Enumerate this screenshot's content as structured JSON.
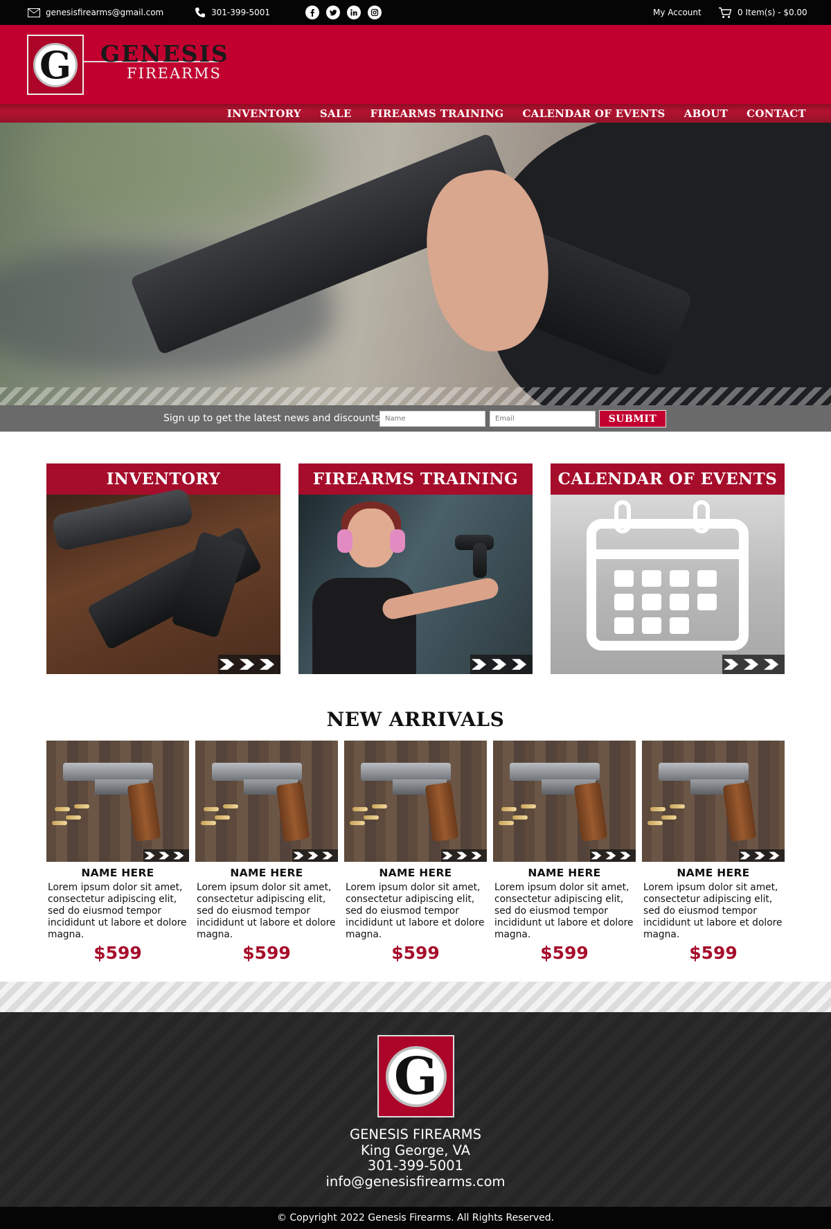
{
  "topbar": {
    "email": "genesisfirearms@gmail.com",
    "phone": "301-399-5001",
    "social": [
      "facebook-icon",
      "twitter-icon",
      "linkedin-icon",
      "instagram-icon"
    ],
    "account": "My Account",
    "cart": "0 Item(s) - $0.00"
  },
  "brand": {
    "logo_letter": "G",
    "name_line1": "GENESIS",
    "name_line2": "FIREARMS"
  },
  "nav": {
    "items": [
      "INVENTORY",
      "SALE",
      "FIREARMS TRAINING",
      "CALENDAR OF EVENTS",
      "ABOUT",
      "CONTACT"
    ]
  },
  "signup": {
    "label": "Sign up to get the latest news and discounts",
    "name_placeholder": "Name",
    "email_placeholder": "Email",
    "submit": "SUBMIT"
  },
  "features": [
    {
      "title": "INVENTORY"
    },
    {
      "title": "FIREARMS TRAINING"
    },
    {
      "title": "CALENDAR OF EVENTS"
    }
  ],
  "new_arrivals": {
    "title": "NEW ARRIVALS",
    "products": [
      {
        "name": "NAME HERE",
        "desc": "Lorem ipsum dolor sit amet, consectetur adipiscing elit, sed do eiusmod tempor incididunt ut labore et dolore magna.",
        "price": "$599"
      },
      {
        "name": "NAME HERE",
        "desc": "Lorem ipsum dolor sit amet, consectetur adipiscing elit, sed do eiusmod tempor incididunt ut labore et dolore magna.",
        "price": "$599"
      },
      {
        "name": "NAME HERE",
        "desc": "Lorem ipsum dolor sit amet, consectetur adipiscing elit, sed do eiusmod tempor incididunt ut labore et dolore magna.",
        "price": "$599"
      },
      {
        "name": "NAME HERE",
        "desc": "Lorem ipsum dolor sit amet, consectetur adipiscing elit, sed do eiusmod tempor incididunt ut labore et dolore magna.",
        "price": "$599"
      },
      {
        "name": "NAME HERE",
        "desc": "Lorem ipsum dolor sit amet, consectetur adipiscing elit, sed do eiusmod tempor incididunt ut labore et dolore magna.",
        "price": "$599"
      }
    ]
  },
  "footer": {
    "logo_letter": "G",
    "company": "GENESIS FIREARMS",
    "location": "King George, VA",
    "phone": "301-399-5001",
    "email": "info@genesisfirearms.com",
    "copyright": "© Copyright 2022 Genesis Firearms. All Rights Reserved."
  },
  "colors": {
    "brand_red": "#c20030",
    "dark_red": "#a60d2b",
    "topbar_bg": "#050505",
    "footer_bg": "#2b2b2b"
  }
}
